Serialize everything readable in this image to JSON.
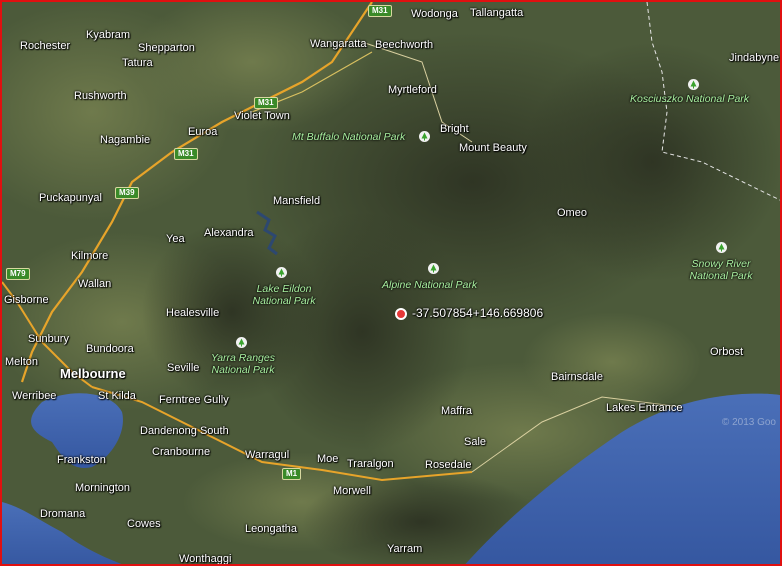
{
  "map": {
    "type": "satellite-map",
    "colors": {
      "land": "#4a5a38",
      "sea": "#3d5fa8",
      "border": "#e01010",
      "park_label": "#a9f0a0"
    },
    "towns": [
      {
        "name": "Wodonga"
      },
      {
        "name": "Tallangatta"
      },
      {
        "name": "Rochester"
      },
      {
        "name": "Kyabram"
      },
      {
        "name": "Shepparton"
      },
      {
        "name": "Wangaratta"
      },
      {
        "name": "Beechworth"
      },
      {
        "name": "Jindabyne"
      },
      {
        "name": "Tatura"
      },
      {
        "name": "Myrtleford"
      },
      {
        "name": "Rushworth"
      },
      {
        "name": "Violet Town"
      },
      {
        "name": "Bright"
      },
      {
        "name": "Nagambie"
      },
      {
        "name": "Euroa"
      },
      {
        "name": "Mount Beauty"
      },
      {
        "name": "Puckapunyal"
      },
      {
        "name": "Mansfield"
      },
      {
        "name": "Omeo"
      },
      {
        "name": "Alexandra"
      },
      {
        "name": "Yea"
      },
      {
        "name": "Kilmore"
      },
      {
        "name": "Wallan"
      },
      {
        "name": "Gisborne"
      },
      {
        "name": "Healesville"
      },
      {
        "name": "Sunbury"
      },
      {
        "name": "Bundoora"
      },
      {
        "name": "Orbost"
      },
      {
        "name": "Melton"
      },
      {
        "name": "Melbourne"
      },
      {
        "name": "Seville"
      },
      {
        "name": "Bairnsdale"
      },
      {
        "name": "Werribee"
      },
      {
        "name": "St Kilda"
      },
      {
        "name": "Ferntree Gully"
      },
      {
        "name": "Maffra"
      },
      {
        "name": "Lakes Entrance"
      },
      {
        "name": "Dandenong South"
      },
      {
        "name": "Sale"
      },
      {
        "name": "Cranbourne"
      },
      {
        "name": "Warragul"
      },
      {
        "name": "Moe"
      },
      {
        "name": "Traralgon"
      },
      {
        "name": "Rosedale"
      },
      {
        "name": "Frankston"
      },
      {
        "name": "Morwell"
      },
      {
        "name": "Mornington"
      },
      {
        "name": "Dromana"
      },
      {
        "name": "Cowes"
      },
      {
        "name": "Leongatha"
      },
      {
        "name": "Yarram"
      },
      {
        "name": "Wonthaggi"
      }
    ],
    "parks": [
      {
        "name": "Kosciuszko National Park"
      },
      {
        "name": "Mt Buffalo National Park"
      },
      {
        "name": "Alpine National Park"
      },
      {
        "name": "Snowy River National Park"
      },
      {
        "name": "Lake Eildon National Park"
      },
      {
        "name": "Yarra Ranges National Park"
      }
    ],
    "highways": [
      "M31",
      "M31",
      "M31",
      "M39",
      "M79",
      "M1"
    ],
    "marker": {
      "label": "-37.507854+146.669806",
      "lat": -37.507854,
      "lng": 146.669806
    },
    "copyright": "© 2013 Goo"
  }
}
